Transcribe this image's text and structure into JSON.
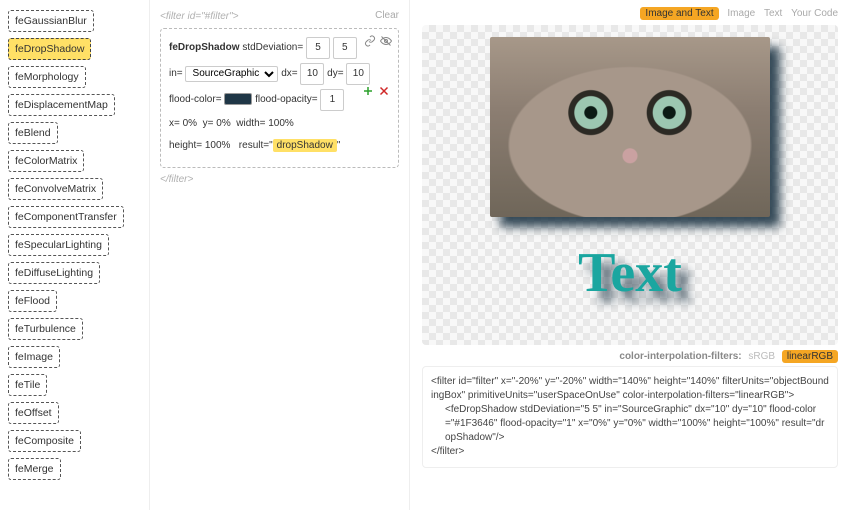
{
  "primitives": [
    "feGaussianBlur",
    "feDropShadow",
    "feMorphology",
    "feDisplacementMap",
    "feBlend",
    "feColorMatrix",
    "feConvolveMatrix",
    "feComponentTransfer",
    "feSpecularLighting",
    "feDiffuseLighting",
    "feFlood",
    "feTurbulence",
    "feImage",
    "feTile",
    "feOffset",
    "feComposite",
    "feMerge"
  ],
  "selected_primitive": "feDropShadow",
  "filter_open_tag": "<filter id=\"#filter\">",
  "filter_close_tag": "</filter>",
  "clear_label": "Clear",
  "box": {
    "name_label": "feDropShadow",
    "stdDeviation_label": "stdDeviation=",
    "stdDeviation_x": "5",
    "stdDeviation_y": "5",
    "in_label": "in=",
    "in_value": "SourceGraphic",
    "dx_label": "dx=",
    "dx_value": "10",
    "dy_label": "dy=",
    "dy_value": "10",
    "flood_color_label": "flood-color=",
    "flood_color_value": "#1F3646",
    "flood_opacity_label": "flood-opacity=",
    "flood_opacity_value": "1",
    "x_label": "x=",
    "x_value": "0%",
    "y_label": "y=",
    "y_value": "0%",
    "width_label": "width=",
    "width_value": "100%",
    "height_label": "height=",
    "height_value": "100%",
    "result_label": "result=",
    "result_value": "dropShadow"
  },
  "tabs": {
    "image_and_text": "Image and Text",
    "image": "Image",
    "text": "Text",
    "your_code": "Your Code",
    "active": "image_and_text"
  },
  "preview_text": "Text",
  "cif": {
    "label": "color-interpolation-filters:",
    "srgb": "sRGB",
    "linearrgb": "linearRGB",
    "active": "linearrgb"
  },
  "code": {
    "line1": "<filter id=\"filter\" x=\"-20%\" y=\"-20%\" width=\"140%\" height=\"140%\" filterUnits=\"objectBoundingBox\" primitiveUnits=\"userSpaceOnUse\" color-interpolation-filters=\"linearRGB\">",
    "line2": "<feDropShadow stdDeviation=\"5 5\" in=\"SourceGraphic\" dx=\"10\" dy=\"10\" flood-color=\"#1F3646\" flood-opacity=\"1\" x=\"0%\" y=\"0%\" width=\"100%\" height=\"100%\" result=\"dropShadow\"/>",
    "line3": "</filter>"
  }
}
